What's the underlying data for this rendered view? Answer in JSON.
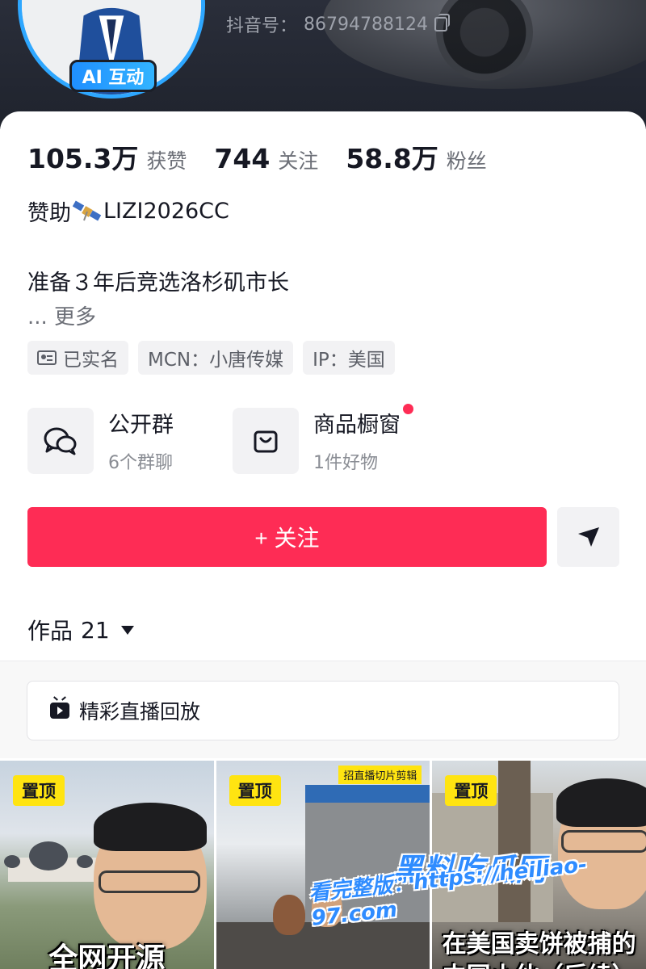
{
  "profile": {
    "douyin_id_label": "抖音号：",
    "douyin_id": "86794788124",
    "ai_badge": "AI 互动"
  },
  "stats": {
    "likes_count": "105.3万",
    "likes_label": "获赞",
    "following_count": "744",
    "following_label": "关注",
    "followers_count": "58.8万",
    "followers_label": "粉丝"
  },
  "sponsor": {
    "prefix": "赞助",
    "handle": "LIZI2026CC"
  },
  "bio": {
    "text": "准备３年后竞选洛杉矶市长",
    "more": "... 更多"
  },
  "tags": [
    {
      "label": "已实名"
    },
    {
      "label": "MCN：小唐传媒"
    },
    {
      "label": "IP：美国"
    }
  ],
  "features": {
    "group": {
      "title": "公开群",
      "subtitle": "6个群聊"
    },
    "shop": {
      "title": "商品橱窗",
      "subtitle": "1件好物"
    }
  },
  "actions": {
    "follow": "+ 关注"
  },
  "works": {
    "label": "作品",
    "count": "21"
  },
  "live_replay": {
    "label": "精彩直播回放"
  },
  "videos": [
    {
      "pin": "置顶",
      "caption": "全网开源"
    },
    {
      "pin": "置顶",
      "corner_label": "招直播切片剪辑"
    },
    {
      "pin": "置顶",
      "caption": "在美国卖饼被捕的中国小伙（后续）"
    }
  ],
  "watermark": {
    "title": "黑料吃瓜网",
    "link": "看完整版：https://heiliao-97.com"
  },
  "colors": {
    "accent": "#fe2c55",
    "pin_yellow": "#ffe411",
    "ai_blue": "#2ea7ff"
  }
}
